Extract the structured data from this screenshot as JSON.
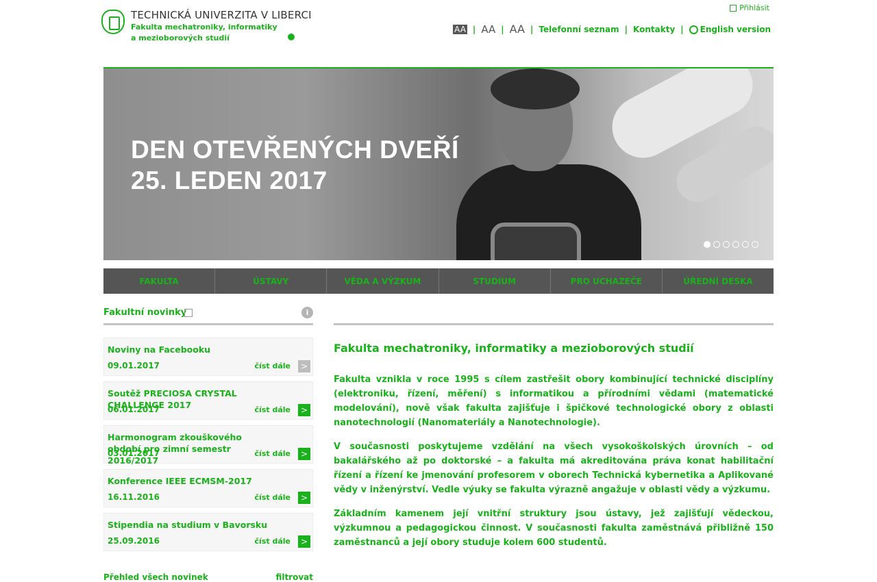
{
  "header": {
    "logo_title": "TECHNICKÁ UNIVERZITA V LIBERCI",
    "logo_sub1": "Fakulta mechatroniky, informatiky",
    "logo_sub2": "a mezioborových studií",
    "login": "Přihlásit",
    "font_small": "AA",
    "font_medium": "AA",
    "font_large": "AA",
    "phone_book": "Telefonní seznam",
    "contacts": "Kontakty",
    "english": "English version"
  },
  "banner": {
    "line1": "DEN OTEVŘENÝCH DVEŘÍ",
    "line2": "25. LEDEN 2017",
    "slides": 6,
    "active_slide": 1
  },
  "nav": {
    "items": [
      "FAKULTA",
      "ÚSTAVY",
      "VĚDA A VÝZKUM",
      "STUDIUM",
      "PRO UCHAZEČE",
      "ÚŘEDNÍ DESKA"
    ]
  },
  "news": {
    "heading": "Fakultní novinky",
    "items": [
      {
        "title": "Noviny na Facebooku",
        "date": "09.01.2017",
        "more": "číst dále"
      },
      {
        "title": "Soutěž PRECIOSA CRYSTAL CHALLENGE 2017",
        "date": "06.01.2017",
        "more": "číst dále"
      },
      {
        "title": "Harmonogram zkouškového období pro zimní semestr 2016/2017",
        "date": "03.01.2017",
        "more": "číst dále"
      },
      {
        "title": "Konference IEEE ECMSM-2017",
        "date": "16.11.2016",
        "more": "číst dále"
      },
      {
        "title": "Stipendia na studium v Bavorsku",
        "date": "25.09.2016",
        "more": "číst dále"
      }
    ],
    "all_news": "Přehled všech novinek",
    "filter": "filtrovat"
  },
  "main": {
    "heading": "Fakulta mechatroniky, informatiky a mezioborových studií",
    "p1": "Fakulta vznikla v roce 1995 s cílem zastřešit obory kombinující technické disciplíny (elektroniku, řízení, měření) s informatikou a přírodními vědami (matematické modelování), nově však fakulta zajišťuje i špičkové technologické obory z oblasti nanotechnologií (Nanomateriály a Nanotechnologie).",
    "p2": "V současnosti poskytujeme vzdělání na všech vysokoškolských úrovních – od bakalářského až po doktorské – a fakulta má akreditována práva konat habilitační řízení a řízení ke jmenování profesorem v oborech Technická kybernetika a Aplikované vědy v inženýrství. Vedle výuky se fakulta výrazně angažuje v oblasti vědy a výzkumu.",
    "p3": "Základním kamenem její vnitřní struktury jsou ústavy, jež zajišťují vědeckou, výzkumnou a pedagogickou činnost. V současnosti fakulta zaměstnává přibližně 150 zaměstnanců a její obory studuje kolem 600 studentů."
  },
  "colors": {
    "accent": "#1ab21a",
    "nav_bg": "#555555",
    "rule": "#c4c4c4"
  }
}
